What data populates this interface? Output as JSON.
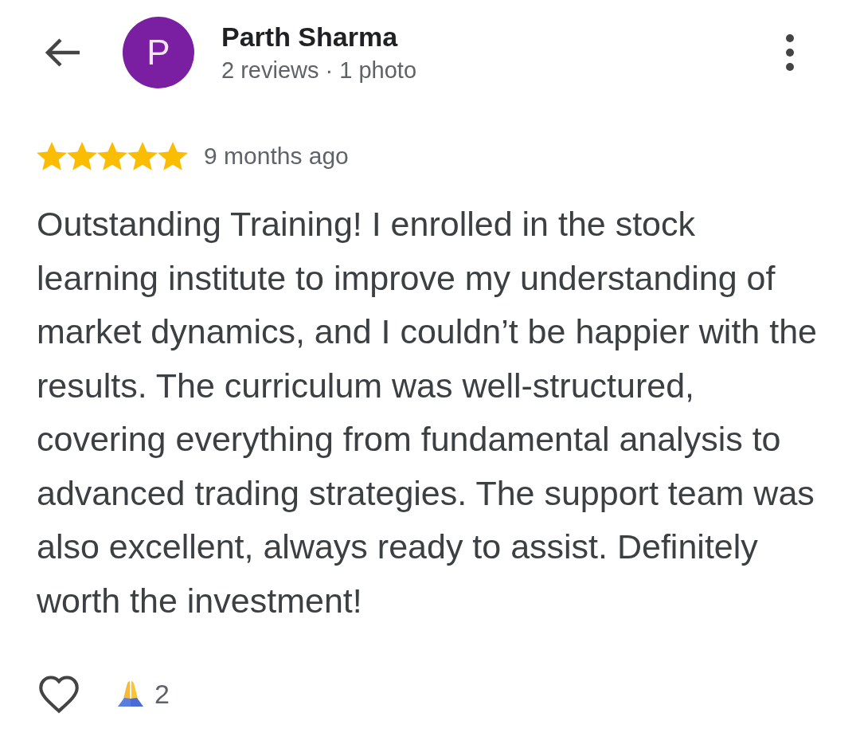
{
  "reviewer": {
    "initial": "P",
    "name": "Parth Sharma",
    "meta": "2 reviews · 1 photo"
  },
  "review": {
    "stars": 5,
    "time": "9 months ago",
    "text": "Outstanding Training! I enrolled in the stock learning institute to improve my understanding of market dynamics, and I couldn’t be happier with the results. The curriculum was well-structured, covering everything from fundamental analysis to advanced trading strategies. The support team was also excellent, always ready to assist. Definitely worth the investment!"
  },
  "reactions": {
    "liked": false,
    "count": "2"
  }
}
